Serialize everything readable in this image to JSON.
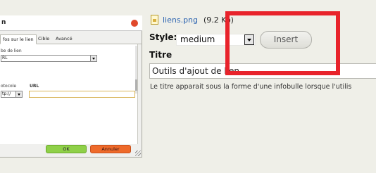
{
  "dialog": {
    "title": "n",
    "tabs": [
      "fos sur le lien",
      "Cible",
      "Avancé"
    ],
    "link_type_label": "be de lien",
    "link_type_value": "RL",
    "protocol_label": "otocole",
    "protocol_value": "tp://",
    "url_label": "URL",
    "url_value": "",
    "ok_label": "OK",
    "cancel_label": "Annuler"
  },
  "file": {
    "icon": "image-file-icon",
    "name": "liens.png",
    "size": "(9.2 Ko)"
  },
  "style": {
    "label": "Style:",
    "value": "medium"
  },
  "insert_label": "Insert",
  "titre": {
    "label": "Titre",
    "value": "Outils d'ajout de lien",
    "help": "Le titre apparait sous la forme d'une infobulle lorsque l'utilis"
  },
  "colors": {
    "highlight": "#e8232b",
    "link": "#2a62b0",
    "ok_button": "#8fd048",
    "cancel_button": "#ee6a2a"
  }
}
